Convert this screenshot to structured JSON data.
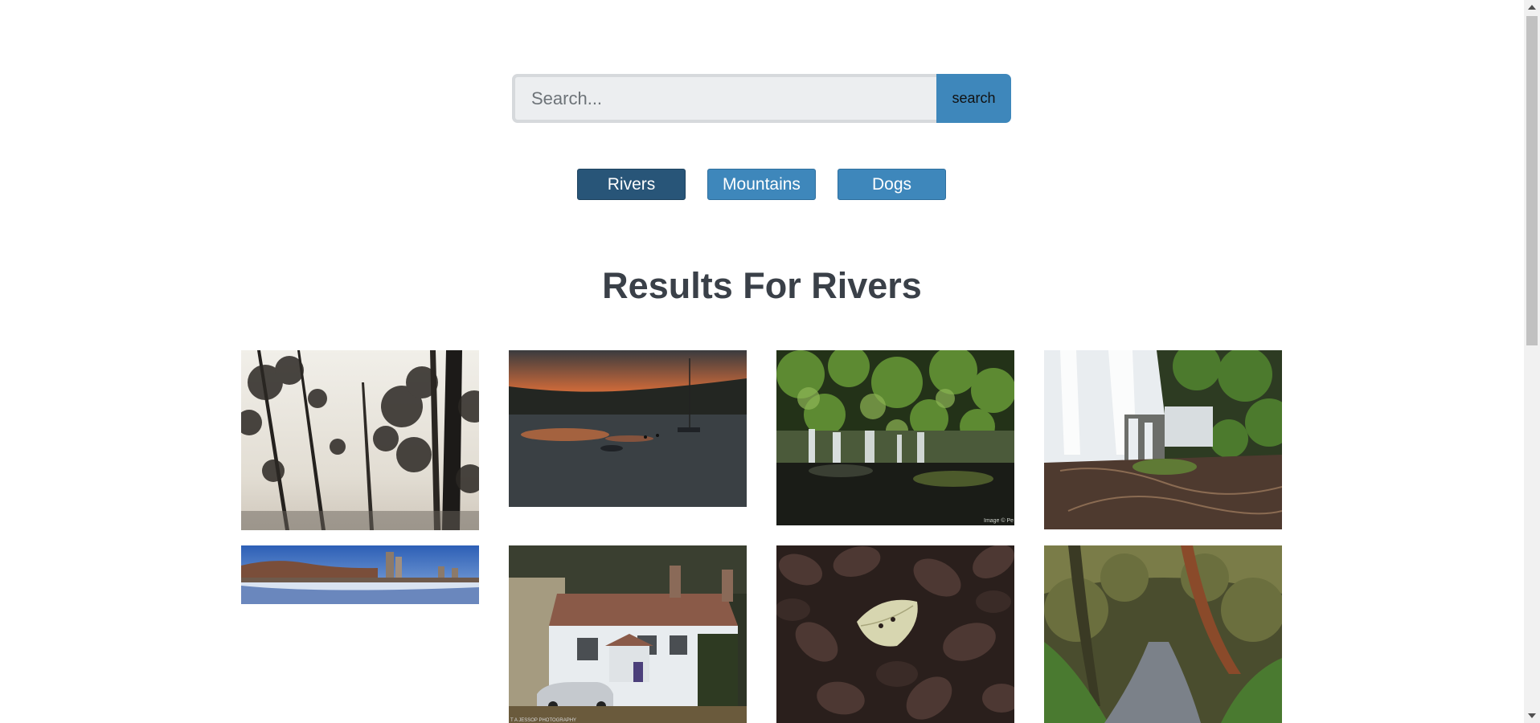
{
  "search": {
    "placeholder": "Search...",
    "button_label": "search"
  },
  "categories": [
    {
      "label": "Rivers",
      "active": true
    },
    {
      "label": "Mountains",
      "active": false
    },
    {
      "label": "Dogs",
      "active": false
    }
  ],
  "results": {
    "title": "Results For Rivers"
  },
  "photos": [
    {
      "subject": "trees silhouetted against pale sky"
    },
    {
      "subject": "sunset over calm river with boats"
    },
    {
      "subject": "small waterfall in forest"
    },
    {
      "subject": "long-exposure waterfall with rocks"
    },
    {
      "subject": "snowy river panorama with city towers"
    },
    {
      "subject": "white cottage with car in front"
    },
    {
      "subject": "leaf on dark fallen leaves"
    },
    {
      "subject": "path under arched trees"
    }
  ],
  "photo_captions": {
    "waterfall_watermark": "Image © Pe",
    "cottage_watermark": "T A JESSOP PHOTOGRAPHY"
  }
}
